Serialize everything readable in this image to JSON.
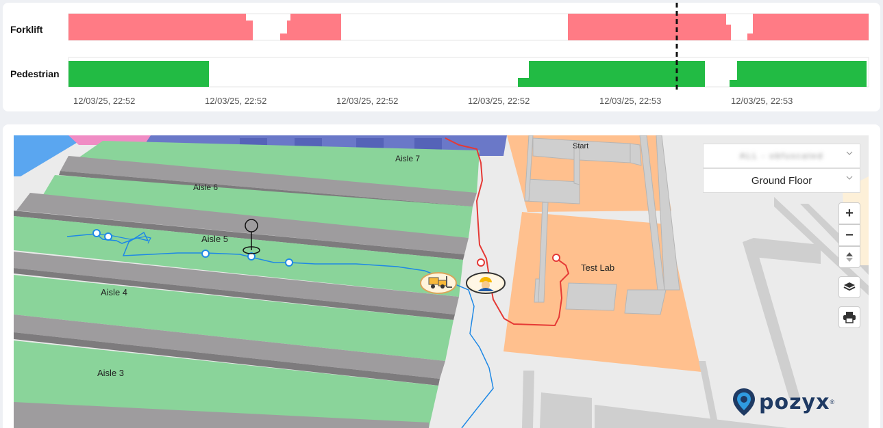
{
  "timeline": {
    "rows": [
      {
        "label": "Forklift",
        "color": "#ff7b85"
      },
      {
        "label": "Pedestrian",
        "color": "#22bb44"
      }
    ],
    "timestamps": [
      "12/03/25, 22:52",
      "12/03/25, 22:52",
      "12/03/25, 22:52",
      "12/03/25, 22:52",
      "12/03/25, 22:53",
      "12/03/25, 22:53"
    ]
  },
  "map": {
    "floor_select": {
      "value": "Ground Floor"
    },
    "project_select": {
      "value": "ALL - obfuscated"
    },
    "labels": {
      "aisle7": "Aisle 7",
      "aisle6": "Aisle 6",
      "aisle5": "Aisle 5",
      "aisle4": "Aisle 4",
      "aisle3": "Aisle 3",
      "start": "Start",
      "test_lab": "Test Lab"
    },
    "controls": {
      "zoom_in": "+",
      "zoom_out": "−"
    },
    "colors": {
      "shelf_green": "#8ad49a",
      "shelf_gray": "#9e9c9e",
      "room_orange": "#ffc08e",
      "wall_gray": "#c8c8c8",
      "forklift_path": "#1e88e5",
      "pedestrian_path": "#e53935"
    },
    "icons": {
      "forklift": "forklift-icon",
      "pedestrian": "worker-icon",
      "anchor": "anchor-pin-icon"
    }
  },
  "brand": {
    "name": "pozyx",
    "reg": "®"
  }
}
